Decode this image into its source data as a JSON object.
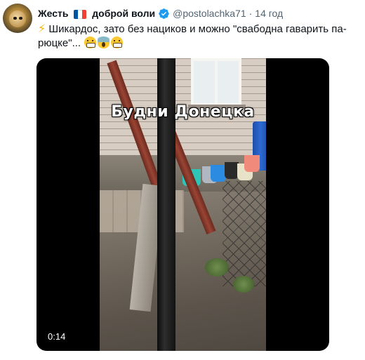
{
  "tweet": {
    "author_name_part1": "Жесть",
    "author_name_part2": "доброй воли",
    "flag": [
      "#0055a4",
      "#ffffff",
      "#ef4135"
    ],
    "verified_color": "#1d9bf0",
    "handle": "@postolachka71",
    "separator": "·",
    "time": "14 год",
    "text": "Шикардос, зато без нациков и можно \"свабодна гаварить па-рюцке\"...",
    "emojis": [
      "high-voltage-emoji",
      "grimacing-emoji",
      "screaming-emoji",
      "grimacing-emoji"
    ]
  },
  "video": {
    "caption": "Будни Донецка",
    "duration": "0:14"
  }
}
